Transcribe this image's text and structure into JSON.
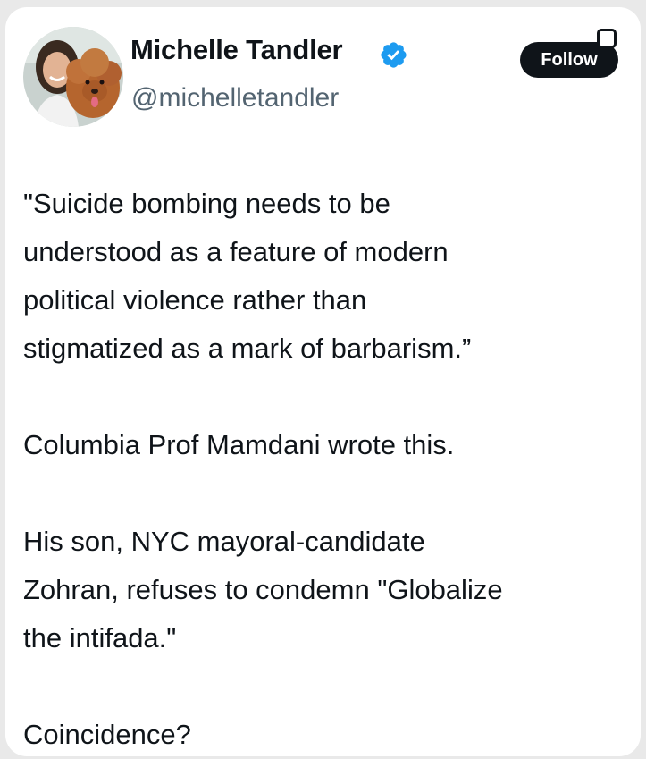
{
  "author": {
    "name": "Michelle Tandler",
    "handle": "@michelletandler",
    "verified_icon": "verified-badge-icon",
    "avatar_icon": "profile-photo-with-dog"
  },
  "follow_button": {
    "label": "Follow"
  },
  "tweet": {
    "paragraphs": [
      [
        "\"Suicide bombing needs to be",
        "understood as a feature of modern",
        "political violence rather than",
        "stigmatized as a mark of barbarism.”"
      ],
      [
        "Columbia Prof Mamdani wrote this."
      ],
      [
        "His son, NYC mayoral-candidate",
        "Zohran, refuses to condemn \"Globalize",
        "the intifada.\""
      ],
      [
        "Coincidence?"
      ]
    ]
  },
  "colors": {
    "text": "#0f1419",
    "secondary_text": "#536471",
    "verified_blue": "#1d9bf0",
    "button_bg": "#0f1419"
  }
}
